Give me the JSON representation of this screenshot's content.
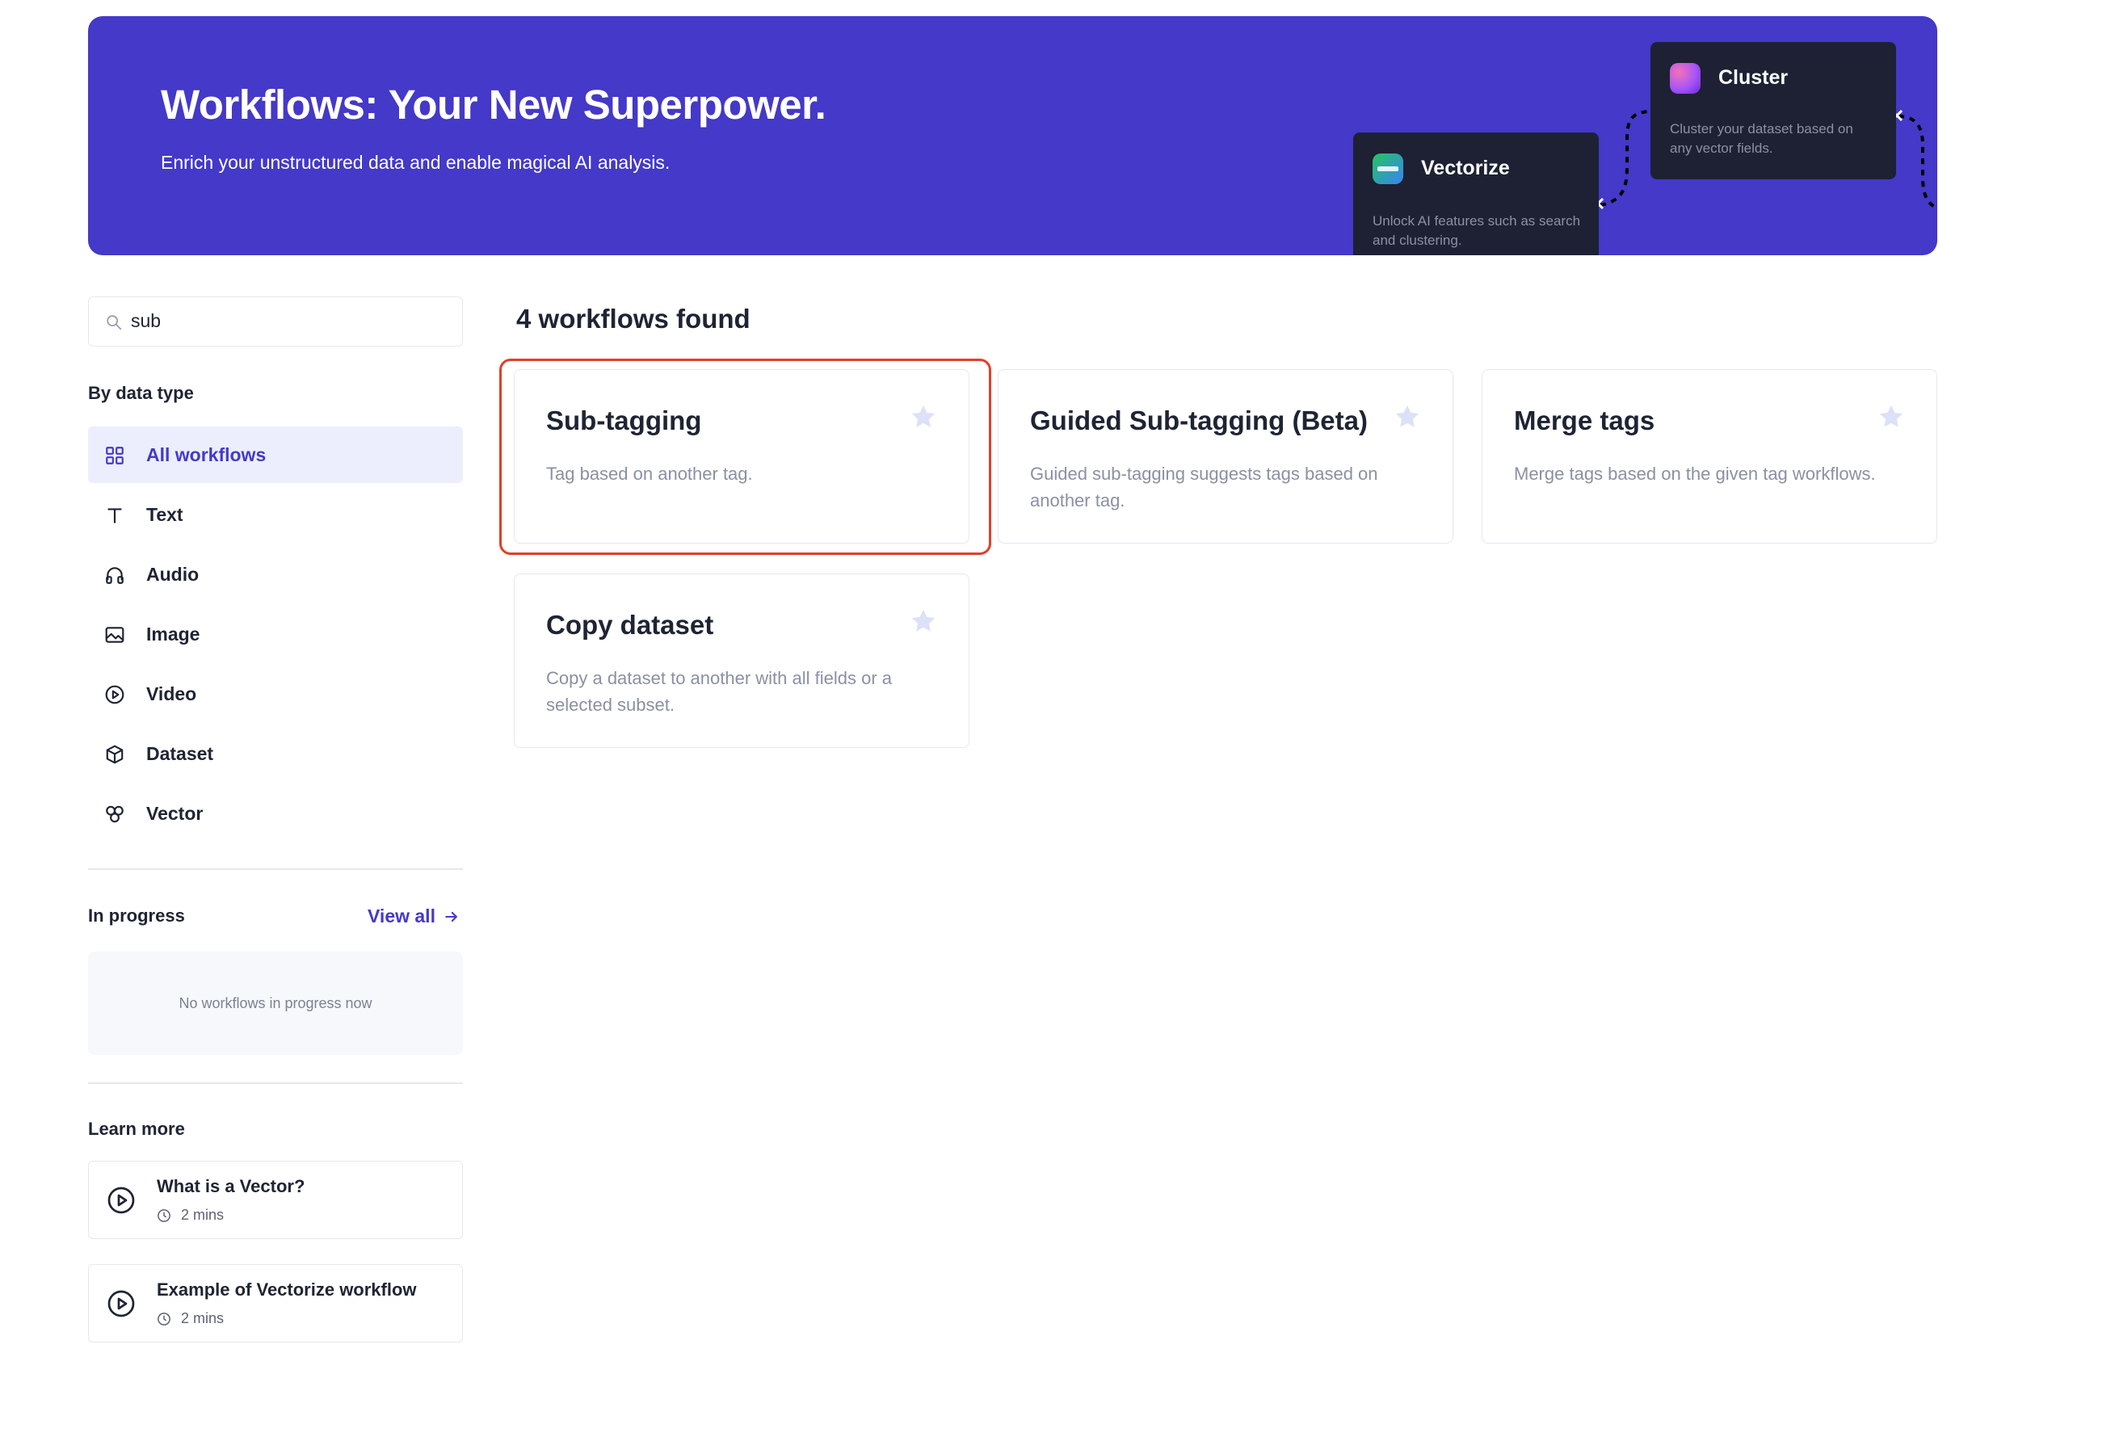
{
  "banner": {
    "title": "Workflows: Your New Superpower.",
    "subtitle": "Enrich your unstructured data and enable magical AI analysis.",
    "cards": {
      "vectorize": {
        "title": "Vectorize",
        "description": "Unlock AI features such as search and clustering."
      },
      "cluster": {
        "title": "Cluster",
        "description": "Cluster your dataset based on any vector fields."
      }
    }
  },
  "sidebar": {
    "search": {
      "value": "sub",
      "icon": "search-icon"
    },
    "by_data_type_title": "By data type",
    "items": [
      {
        "label": "All workflows",
        "icon": "grid-icon",
        "active": true
      },
      {
        "label": "Text",
        "icon": "text-icon"
      },
      {
        "label": "Audio",
        "icon": "headphones-icon"
      },
      {
        "label": "Image",
        "icon": "image-icon"
      },
      {
        "label": "Video",
        "icon": "play-circle-icon"
      },
      {
        "label": "Dataset",
        "icon": "cube-icon"
      },
      {
        "label": "Vector",
        "icon": "vector-icon"
      }
    ],
    "in_progress": {
      "title": "In progress",
      "view_all": "View all",
      "empty_text": "No workflows in progress now"
    },
    "learn_more": {
      "title": "Learn more",
      "items": [
        {
          "title": "What is a Vector?",
          "duration": "2 mins"
        },
        {
          "title": "Example of Vectorize workflow",
          "duration": "2 mins"
        }
      ]
    }
  },
  "main": {
    "results_title": "4 workflows found",
    "workflows": [
      {
        "title": "Sub-tagging",
        "description": "Tag based on another tag."
      },
      {
        "title": "Guided Sub-tagging (Beta)",
        "description": "Guided sub-tagging suggests tags based on another tag."
      },
      {
        "title": "Merge tags",
        "description": "Merge tags based on the given tag workflows."
      },
      {
        "title": "Copy dataset",
        "description": "Copy a dataset to another with all fields or a selected subset."
      }
    ]
  },
  "colors": {
    "accent": "#4439c8",
    "banner_card": "#1d2133",
    "highlight": "#e0402a",
    "star": "#dde1f7"
  }
}
